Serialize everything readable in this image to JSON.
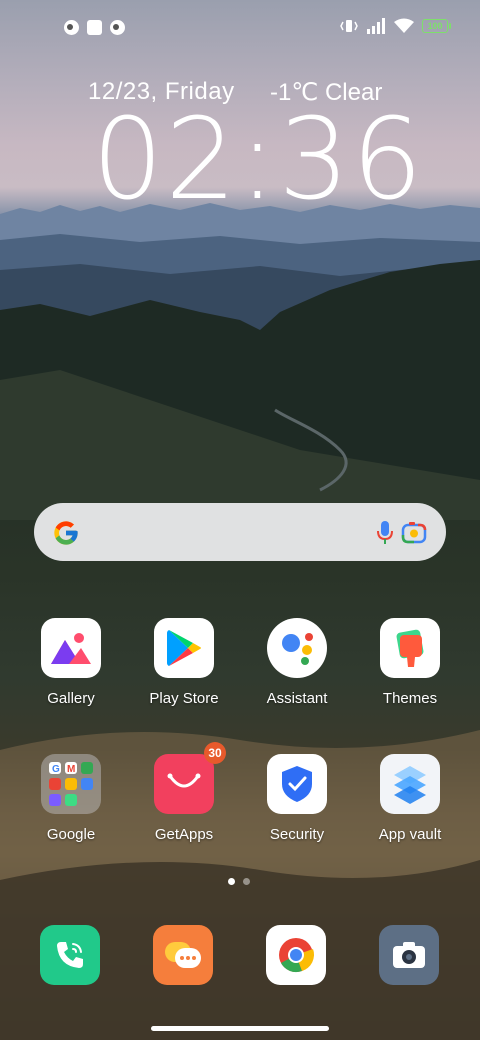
{
  "status_bar": {
    "battery": "100",
    "left_icons": [
      "notification-icon",
      "square-app-icon",
      "notification-icon"
    ],
    "right_icons": [
      "vibrate-icon",
      "signal-icon",
      "wifi-icon",
      "battery-icon"
    ]
  },
  "clock_widget": {
    "date": "12/23, Friday",
    "weather": "-1℃  Clear",
    "time": "02:36"
  },
  "search_bar": {
    "icons": [
      "google-g-icon",
      "microphone-icon",
      "google-lens-icon"
    ]
  },
  "apps_row1": [
    {
      "label": "Gallery"
    },
    {
      "label": "Play Store"
    },
    {
      "label": "Assistant"
    },
    {
      "label": "Themes"
    }
  ],
  "apps_row2": [
    {
      "label": "Google"
    },
    {
      "label": "GetApps",
      "badge": "30"
    },
    {
      "label": "Security"
    },
    {
      "label": "App vault"
    }
  ],
  "dock": [
    "phone-icon",
    "messaging-icon",
    "chrome-icon",
    "camera-icon"
  ],
  "page_indicator": {
    "pages": 2,
    "current": 1
  },
  "colors": {
    "phone": "#21c98a",
    "messaging": "#f57e3c",
    "getapps": "#f2405e",
    "camera": "#5d6f85",
    "badge": "#e85a2c"
  }
}
